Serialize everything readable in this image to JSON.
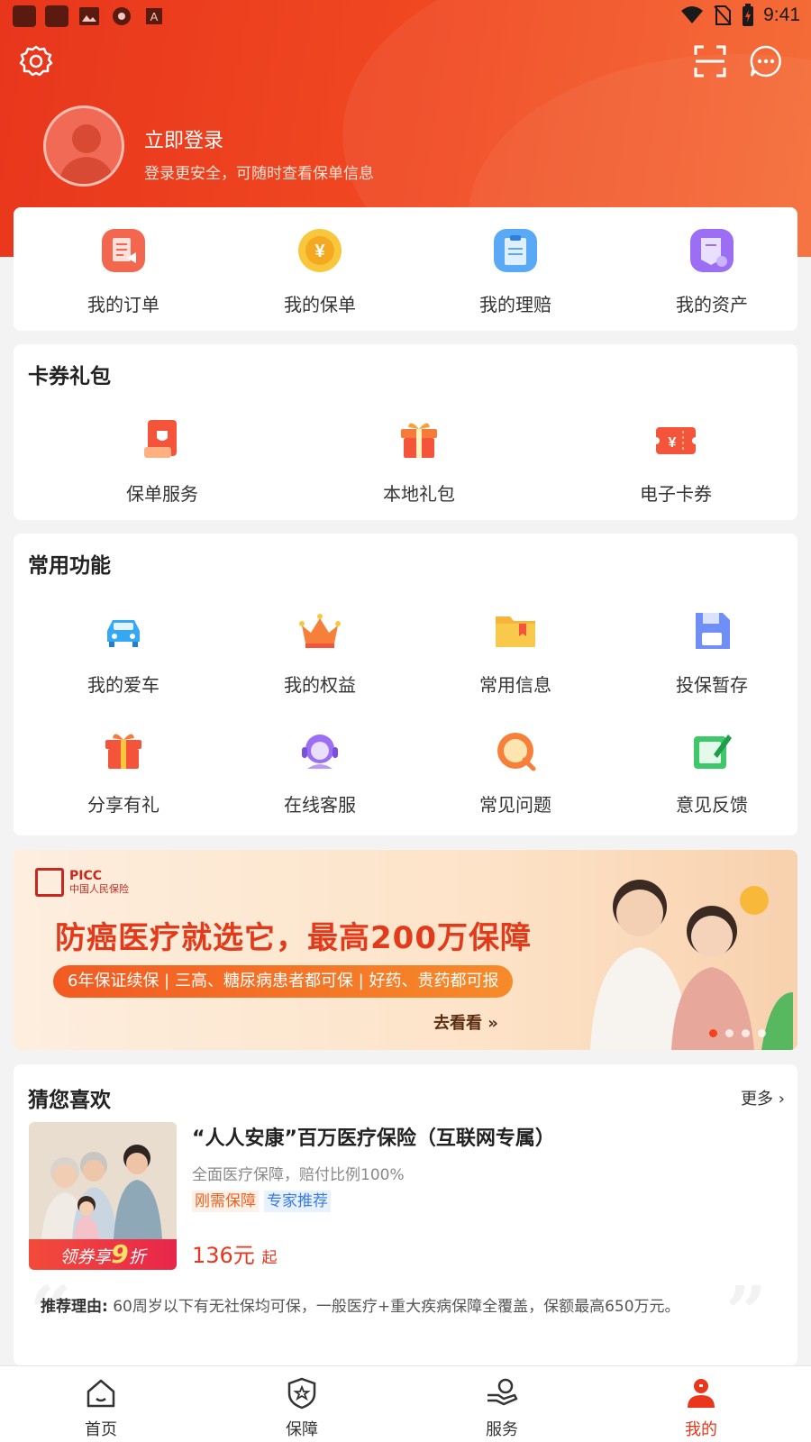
{
  "status_bar": {
    "time": "9:41"
  },
  "header": {
    "settings_icon": "settings-gear-icon",
    "scan_icon": "scan-icon",
    "message_icon": "message-icon",
    "login_title": "立即登录",
    "login_subtitle": "登录更安全，可随时查看保单信息"
  },
  "quick_menu": [
    {
      "label": "我的订单",
      "icon": "order-icon"
    },
    {
      "label": "我的保单",
      "icon": "policy-coin-icon"
    },
    {
      "label": "我的理赔",
      "icon": "claim-icon"
    },
    {
      "label": "我的资产",
      "icon": "asset-icon"
    }
  ],
  "coupons": {
    "title": "卡券礼包",
    "items": [
      {
        "label": "保单服务",
        "icon": "policy-service-icon"
      },
      {
        "label": "本地礼包",
        "icon": "gift-box-icon"
      },
      {
        "label": "电子卡券",
        "icon": "e-coupon-icon"
      }
    ]
  },
  "functions": {
    "title": "常用功能",
    "items": [
      {
        "label": "我的爱车",
        "icon": "car-icon"
      },
      {
        "label": "我的权益",
        "icon": "crown-icon"
      },
      {
        "label": "常用信息",
        "icon": "folder-icon"
      },
      {
        "label": "投保暂存",
        "icon": "save-icon"
      },
      {
        "label": "分享有礼",
        "icon": "gift-icon"
      },
      {
        "label": "在线客服",
        "icon": "customer-service-icon"
      },
      {
        "label": "常见问题",
        "icon": "faq-icon"
      },
      {
        "label": "意见反馈",
        "icon": "feedback-icon"
      }
    ]
  },
  "banner": {
    "brand_en": "PICC",
    "brand_cn": "中国人民保险",
    "headline": "防癌医疗就选它，最高200万保障",
    "subline": "6年保证续保 | 三高、糖尿病患者都可保 | 好药、贵药都可报",
    "cta": "去看看",
    "cta_arrow": "»",
    "dots_total": 4,
    "dots_active": 1
  },
  "recommend": {
    "title": "猜您喜欢",
    "more": "更多",
    "product": {
      "title": "“人人安康”百万医疗保险（互联网专属）",
      "desc": "全面医疗保障，赔付比例100%",
      "tags": [
        "刚需保障",
        "专家推荐"
      ],
      "coupon_prefix": "领券享",
      "coupon_value": "9",
      "coupon_suffix": "折",
      "price": "136元",
      "price_suffix": "起",
      "reason_label": "推荐理由:",
      "reason_text": "60周岁以下有无社保均可保，一般医疗+重大疾病保障全覆盖，保额最高650万元。"
    }
  },
  "tabbar": {
    "items": [
      {
        "label": "首页",
        "icon": "home-icon"
      },
      {
        "label": "保障",
        "icon": "shield-star-icon"
      },
      {
        "label": "服务",
        "icon": "service-hand-icon"
      },
      {
        "label": "我的",
        "icon": "user-icon"
      }
    ],
    "active_index": 3
  },
  "colors": {
    "accent": "#e9361c",
    "header_start": "#e8361c",
    "header_end": "#f5652c"
  }
}
